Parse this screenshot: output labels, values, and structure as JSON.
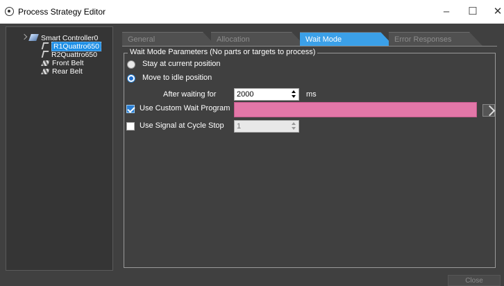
{
  "window": {
    "title": "Process Strategy Editor",
    "minimize_glyph": "–",
    "maximize_glyph": "☐",
    "close_glyph": "✕"
  },
  "tree": {
    "root": {
      "label": "Smart Controller0",
      "icon": "controller-icon"
    },
    "children": [
      {
        "label": "R1Quattro650",
        "icon": "robot-icon",
        "selected": true
      },
      {
        "label": "R2Quattro650",
        "icon": "robot-icon",
        "selected": false
      },
      {
        "label": "Front Belt",
        "icon": "belt-icon",
        "selected": false
      },
      {
        "label": "Rear Belt",
        "icon": "belt-icon",
        "selected": false
      }
    ]
  },
  "tabs": [
    {
      "label": "General",
      "active": false
    },
    {
      "label": "Allocation",
      "active": false
    },
    {
      "label": "Wait Mode",
      "active": true
    },
    {
      "label": "Error Responses",
      "active": false
    }
  ],
  "wait_mode": {
    "group_title": "Wait Mode Parameters (No parts or targets to process)",
    "option_stay": "Stay at current position",
    "option_idle": "Move to idle position",
    "selected_option": "Move to idle position",
    "after_waiting_label": "After waiting for",
    "after_waiting_value": "2000",
    "after_waiting_unit": "ms",
    "custom_program_label": "Use Custom Wait Program",
    "custom_program_checked": true,
    "custom_program_value": "",
    "signal_label": "Use Signal at Cycle Stop",
    "signal_checked": false,
    "signal_value": "1"
  },
  "footer": {
    "close_label": "Close"
  },
  "colors": {
    "active_tab": "#3ba0e8",
    "required_field": "#e377a8",
    "background": "#404040"
  }
}
